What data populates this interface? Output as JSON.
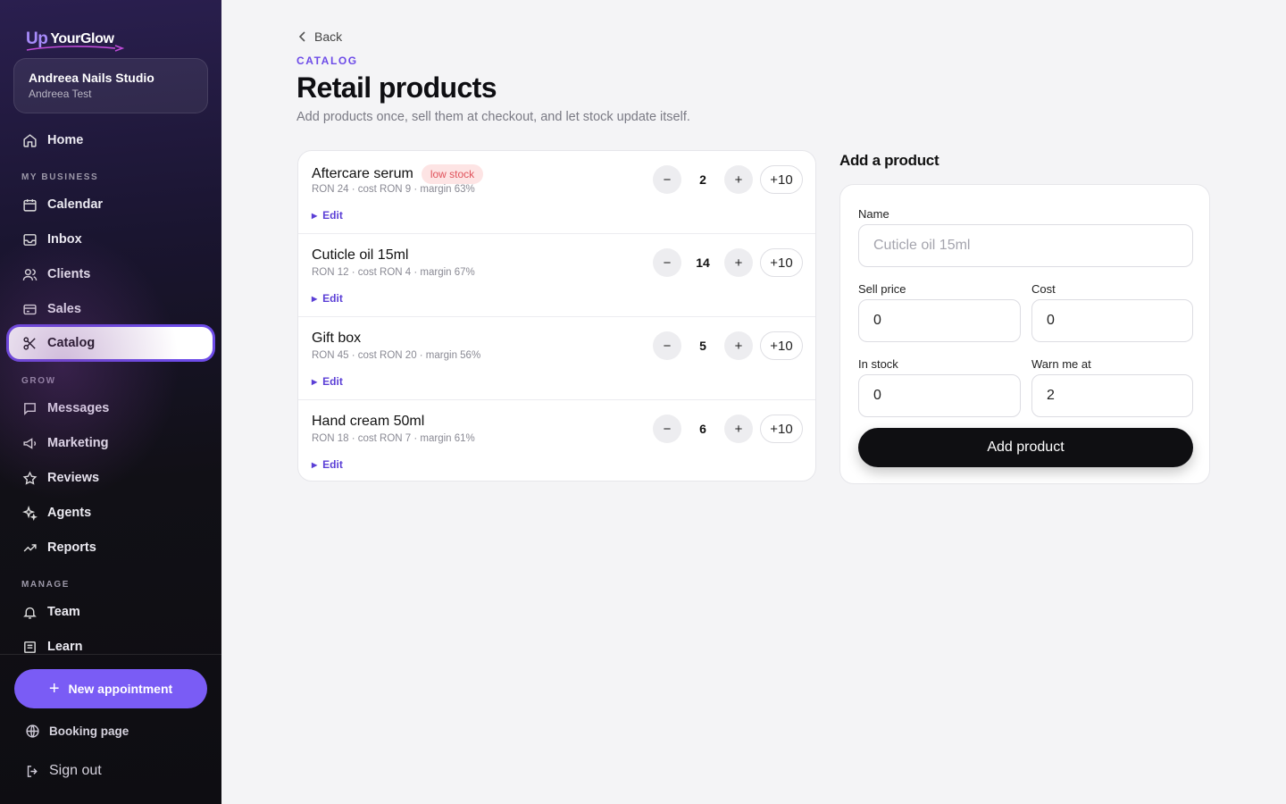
{
  "brand": {
    "logo_up": "Up",
    "logo_name": "YourGlow"
  },
  "studio": {
    "name": "Andreea Nails Studio",
    "user": "Andreea Test"
  },
  "nav": {
    "home": "Home",
    "section_business": "MY BUSINESS",
    "calendar": "Calendar",
    "inbox": "Inbox",
    "clients": "Clients",
    "sales": "Sales",
    "catalog": "Catalog",
    "section_grow": "GROW",
    "messages": "Messages",
    "marketing": "Marketing",
    "reviews": "Reviews",
    "agents": "Agents",
    "reports": "Reports",
    "section_manage": "MANAGE",
    "team": "Team",
    "learn": "Learn",
    "active": "Catalog"
  },
  "sidebar_footer": {
    "new_appointment": "New appointment",
    "booking_page": "Booking page",
    "sign_out": "Sign out"
  },
  "header": {
    "back": "Back",
    "eyebrow": "CATALOG",
    "title": "Retail products",
    "subtitle": "Add products once, sell them at checkout, and let stock update itself."
  },
  "products": [
    {
      "name": "Aftercare serum",
      "badge": "low stock",
      "meta": "RON 24 · cost RON 9 · margin 63%",
      "qty": "2",
      "edit": "Edit",
      "minus": "−",
      "plus": "+",
      "plus10": "+10"
    },
    {
      "name": "Cuticle oil 15ml",
      "badge": "",
      "meta": "RON 12 · cost RON 4 · margin 67%",
      "qty": "14",
      "edit": "Edit",
      "minus": "−",
      "plus": "+",
      "plus10": "+10"
    },
    {
      "name": "Gift box",
      "badge": "",
      "meta": "RON 45 · cost RON 20 · margin 56%",
      "qty": "5",
      "edit": "Edit",
      "minus": "−",
      "plus": "+",
      "plus10": "+10"
    },
    {
      "name": "Hand cream 50ml",
      "badge": "",
      "meta": "RON 18 · cost RON 7 · margin 61%",
      "qty": "6",
      "edit": "Edit",
      "minus": "−",
      "plus": "+",
      "plus10": "+10"
    }
  ],
  "add_form": {
    "title": "Add a product",
    "name_label": "Name",
    "name_placeholder": "Cuticle oil 15ml",
    "name_value": "",
    "sell_price_label": "Sell price",
    "sell_price_value": "0",
    "cost_label": "Cost",
    "cost_value": "0",
    "in_stock_label": "In stock",
    "in_stock_value": "0",
    "warn_label": "Warn me at",
    "warn_value": "2",
    "submit": "Add product"
  },
  "colors": {
    "accent": "#6d4be8",
    "button_purple": "#7a5cf5",
    "badge_bg": "#fde4e4",
    "badge_text": "#e0525b",
    "dark_button": "#0f0f12"
  },
  "icons": {
    "home": "home-icon",
    "calendar": "calendar-icon",
    "inbox": "inbox-icon",
    "clients": "users-icon",
    "sales": "card-icon",
    "catalog": "scissors-icon",
    "messages": "chat-icon",
    "marketing": "megaphone-icon",
    "reviews": "star-icon",
    "agents": "sparkles-icon",
    "reports": "trend-icon",
    "team": "bell-icon",
    "learn": "book-icon",
    "booking_page": "globe-icon",
    "sign_out": "sign-out-icon",
    "back": "chevron-left-icon"
  }
}
